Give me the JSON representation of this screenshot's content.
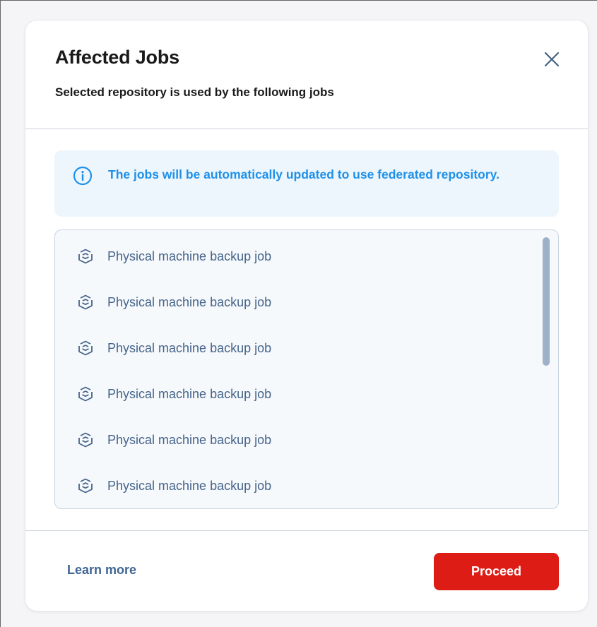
{
  "dialog": {
    "title": "Affected Jobs",
    "subtitle": "Selected repository is used by the following jobs"
  },
  "info": {
    "icon": "info-icon",
    "message": "The jobs will be automatically updated to use federated repository."
  },
  "jobs": [
    {
      "icon": "backup-job-icon",
      "label": "Physical machine backup job"
    },
    {
      "icon": "backup-job-icon",
      "label": "Physical machine backup job"
    },
    {
      "icon": "backup-job-icon",
      "label": "Physical machine backup job"
    },
    {
      "icon": "backup-job-icon",
      "label": "Physical machine backup job"
    },
    {
      "icon": "backup-job-icon",
      "label": "Physical machine backup job"
    },
    {
      "icon": "backup-job-icon",
      "label": "Physical machine backup job"
    }
  ],
  "footer": {
    "learn_more_label": "Learn more",
    "proceed_label": "Proceed"
  },
  "colors": {
    "accent_info": "#1e90e8",
    "primary_danger": "#dd1c16",
    "link": "#3f6592",
    "job_text": "#46648a"
  }
}
